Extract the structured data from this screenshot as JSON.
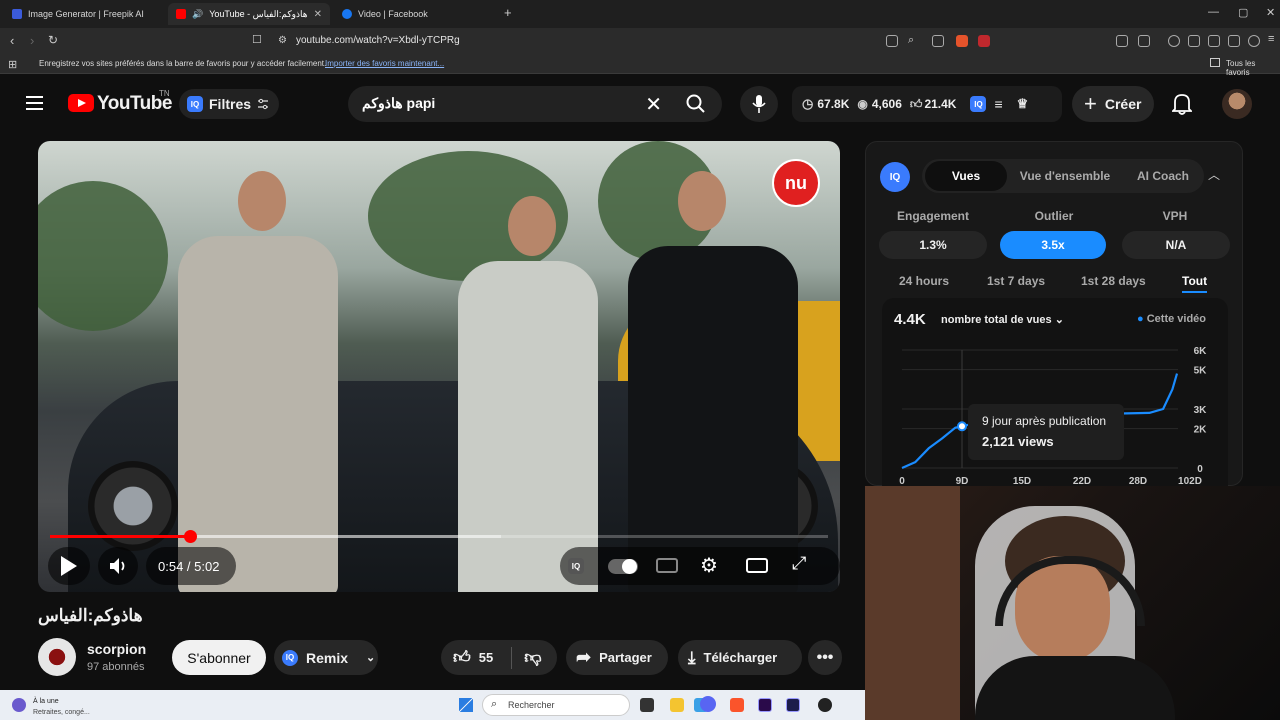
{
  "browser": {
    "tabs": [
      {
        "title": "Image Generator | Freepik AI",
        "favicon_color": "#3b5bdb"
      },
      {
        "title": "YouTube - هاذوكم:الفياس",
        "favicon_color": "#ff0000",
        "active": true
      },
      {
        "title": "Video | Facebook",
        "favicon_color": "#1877f2"
      }
    ],
    "new_tab": "+",
    "url": "youtube.com/watch?v=Xbdl-yTCPRg",
    "bookmarks_message": "Enregistrez vos sites préférés dans la barre de favoris pour y accéder facilement.",
    "bookmarks_link": "Importer des favoris maintenant...",
    "all_favorites": "Tous les favoris"
  },
  "header": {
    "logo_text": "YouTube",
    "logo_suffix": "TN",
    "filters_label": "Filtres",
    "search_value": "هاذوكم papi",
    "stats": {
      "views": "67.8K",
      "watching": "4,606",
      "likes": "21.4K"
    },
    "create_label": "Créer"
  },
  "player": {
    "channel_badge": "nu",
    "current_time": "0:54 / 5:02",
    "progress": 0.18,
    "buffered": 0.58
  },
  "video": {
    "title": "هاذوكم:الفياس",
    "channel": "scorpion",
    "subscribers": "97 abonnés",
    "subscribe_label": "S'abonner",
    "remix_label": "Remix",
    "likes": "55",
    "share_label": "Partager",
    "download_label": "Télécharger"
  },
  "panel": {
    "iq_badge": "IQ",
    "tabs": [
      "Vues",
      "Vue d'ensemble",
      "AI Coach"
    ],
    "metrics": [
      {
        "label": "Engagement",
        "value": "1.3%"
      },
      {
        "label": "Outlier",
        "value": "3.5x"
      },
      {
        "label": "VPH",
        "value": "N/A"
      }
    ],
    "ranges": [
      "24 hours",
      "1st 7 days",
      "1st 28 days",
      "Tout"
    ],
    "total_views": "4.4K",
    "views_dropdown": "nombre total de vues",
    "legend": "Cette vidéo",
    "tooltip_title": "9 jour après publication",
    "tooltip_value": "2,121 views",
    "accent": "#1a8cff"
  },
  "chart_data": {
    "type": "line",
    "y_ticks": [
      "6K",
      "5K",
      "3K",
      "2K",
      "0"
    ],
    "x_ticks": [
      "0",
      "9D",
      "15D",
      "22D",
      "28D",
      "102D"
    ],
    "ylim": [
      0,
      6000
    ],
    "series": [
      {
        "name": "Cette vidéo",
        "x": [
          0,
          2,
          4,
          6,
          8,
          9,
          12,
          20,
          40,
          70,
          90,
          96,
          100,
          102
        ],
        "y": [
          0,
          300,
          1000,
          1500,
          2050,
          2121,
          2200,
          2400,
          2600,
          2750,
          2800,
          3000,
          4000,
          4800
        ]
      }
    ]
  },
  "taskbar": {
    "weather_title": "À la une",
    "weather_sub": "Retraites, congé...",
    "search_placeholder": "Rechercher"
  }
}
